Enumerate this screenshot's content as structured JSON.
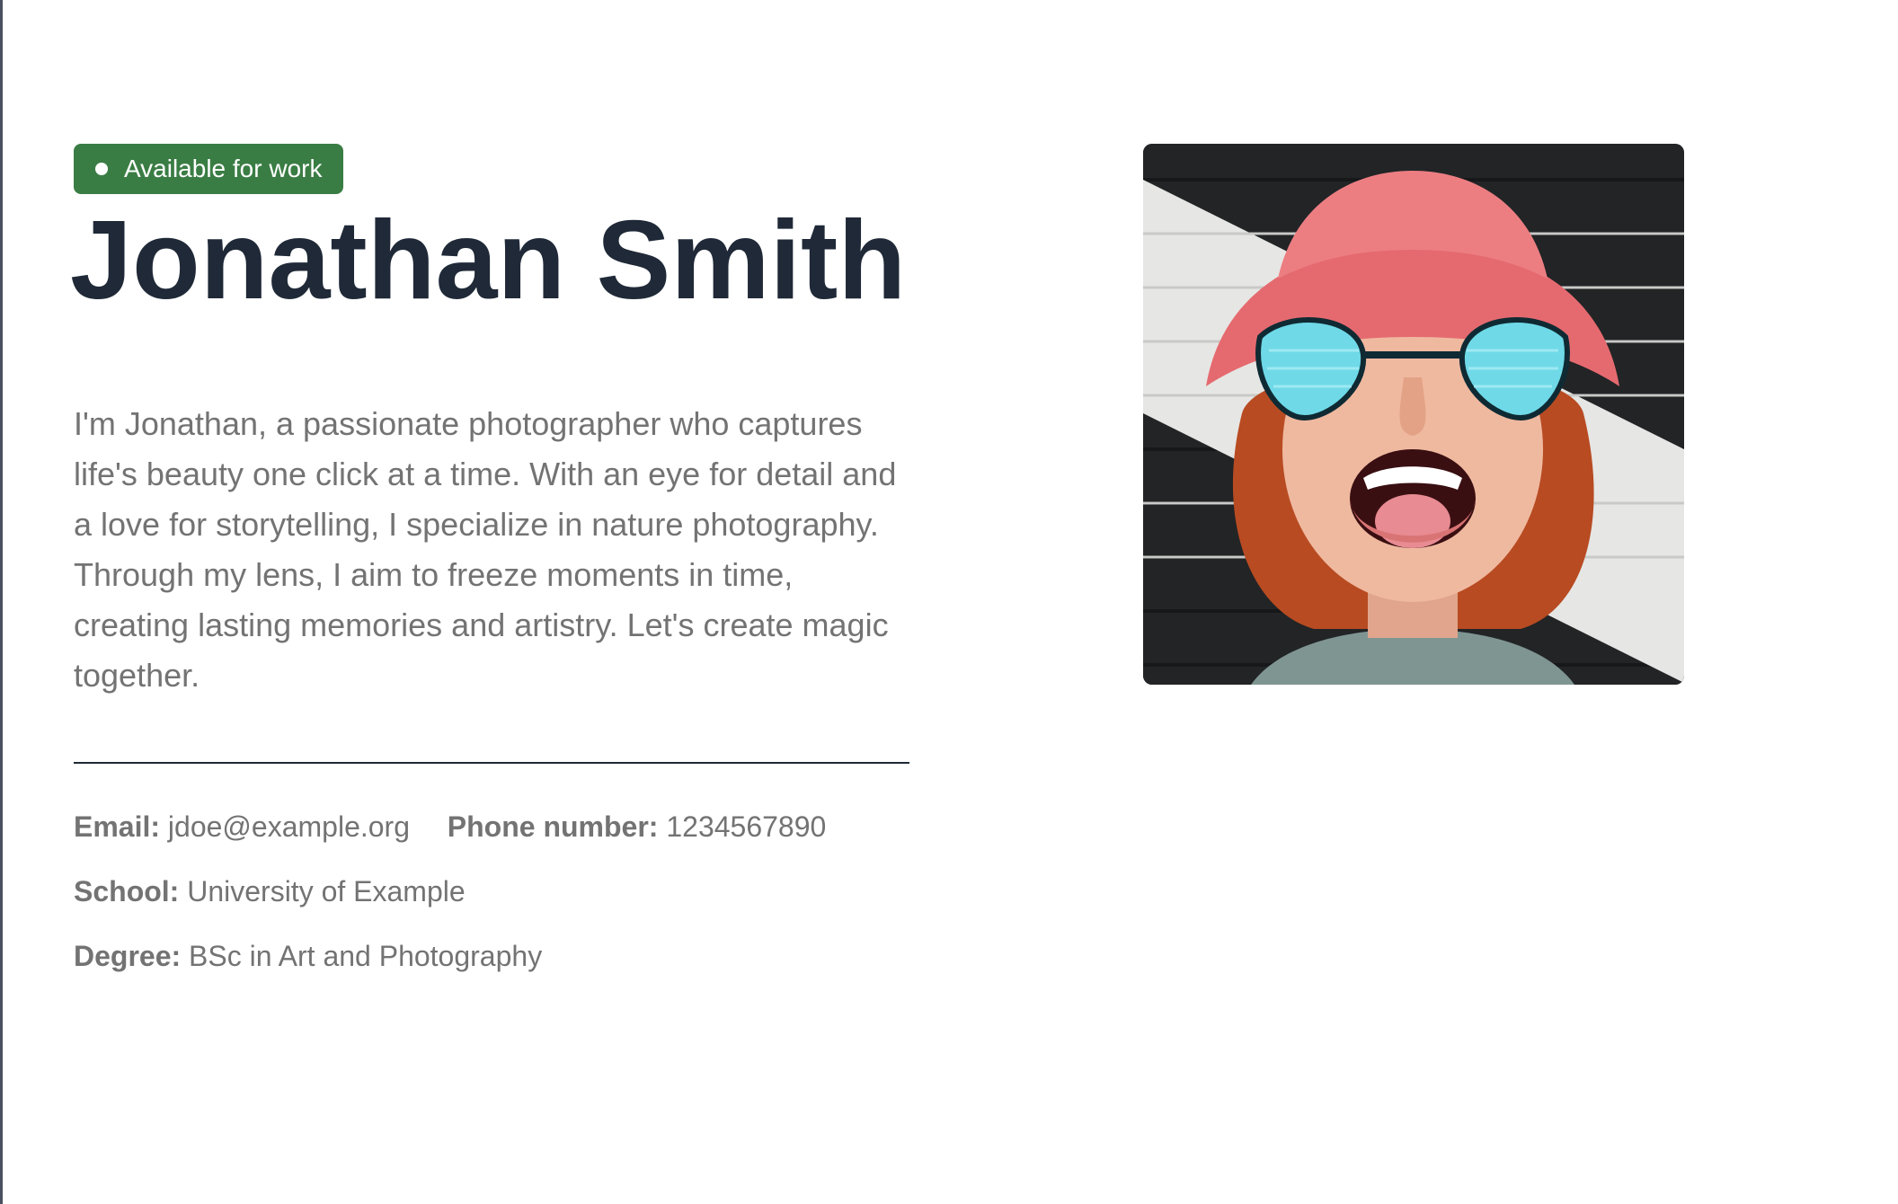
{
  "badge": {
    "label": "Available for work"
  },
  "profile": {
    "name": "Jonathan Smith",
    "bio": "I'm Jonathan, a passionate photographer who captures life's beauty one click at a time. With an eye for detail and a love for storytelling, I specialize in nature photography. Through my lens, I aim to freeze moments in time, creating lasting memories and artistry. Let's create magic together."
  },
  "contact": {
    "email_label": "Email:",
    "email_value": "jdoe@example.org",
    "phone_label": "Phone number:",
    "phone_value": "1234567890",
    "school_label": "School:",
    "school_value": "University of Example",
    "degree_label": "Degree:",
    "degree_value": "BSc in Art and Photography"
  },
  "colors": {
    "badge_bg": "#3a7d44",
    "heading": "#1f2937",
    "body_text": "#737373"
  },
  "icons": {
    "badge_dot": "status-dot-icon"
  }
}
